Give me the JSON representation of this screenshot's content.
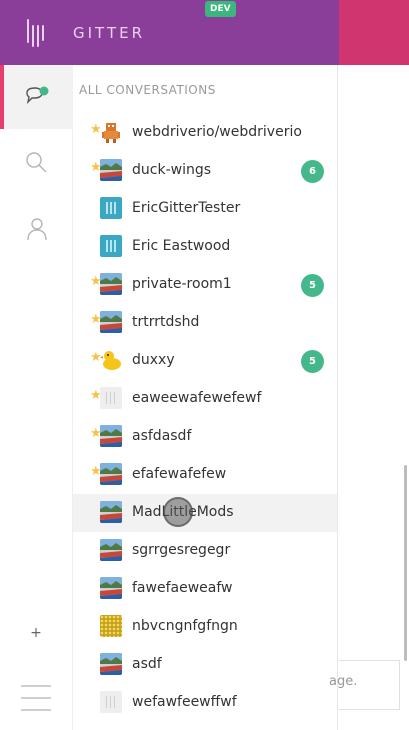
{
  "header": {
    "brand": "GITTER",
    "dev_badge": "DEV",
    "colors": {
      "header_bg": "#8a3e99",
      "avatar_area_bg": "#d1356f",
      "accent": "#e63e6e"
    }
  },
  "rail": {
    "items": [
      {
        "name": "conversations",
        "icon": "chat-bubble-icon",
        "active": true
      },
      {
        "name": "search",
        "icon": "search-icon",
        "active": false
      },
      {
        "name": "people",
        "icon": "person-icon",
        "active": false
      }
    ],
    "add_label": "+",
    "menu_icon": "hamburger-menu-icon"
  },
  "panel": {
    "section_title": "ALL CONVERSATIONS",
    "rooms": [
      {
        "name": "webdriverio/webdriverio",
        "avatar": "robot",
        "starred": true,
        "unread": null
      },
      {
        "name": "duck-wings",
        "avatar": "landscape",
        "starred": true,
        "unread": "6"
      },
      {
        "name": "EricGitterTester",
        "avatar": "gitter",
        "starred": false,
        "unread": null
      },
      {
        "name": "Eric Eastwood",
        "avatar": "gitter",
        "starred": false,
        "unread": null
      },
      {
        "name": "private-room1",
        "avatar": "landscape",
        "starred": true,
        "unread": "5"
      },
      {
        "name": "trtrrtdshd",
        "avatar": "landscape",
        "starred": true,
        "unread": null
      },
      {
        "name": "duxxy",
        "avatar": "duck",
        "starred": true,
        "unread": "5"
      },
      {
        "name": "eaweewafewefewf",
        "avatar": "grey",
        "starred": true,
        "unread": null
      },
      {
        "name": "asfdasdf",
        "avatar": "landscape",
        "starred": true,
        "unread": null
      },
      {
        "name": "efafewafefew",
        "avatar": "landscape",
        "starred": true,
        "unread": null
      },
      {
        "name": "MadLittleMods",
        "avatar": "landscape",
        "starred": false,
        "unread": null,
        "hover": true
      },
      {
        "name": "sgrrgesregegr",
        "avatar": "landscape",
        "starred": false,
        "unread": null
      },
      {
        "name": "fawefaeweafw",
        "avatar": "landscape",
        "starred": false,
        "unread": null
      },
      {
        "name": "nbvcngnfgfngn",
        "avatar": "pattern",
        "starred": false,
        "unread": null
      },
      {
        "name": "asdf",
        "avatar": "landscape",
        "starred": false,
        "unread": null
      },
      {
        "name": "wefawfeewffwf",
        "avatar": "grey",
        "starred": false,
        "unread": null
      }
    ]
  },
  "chat": {
    "input_text": "age."
  }
}
